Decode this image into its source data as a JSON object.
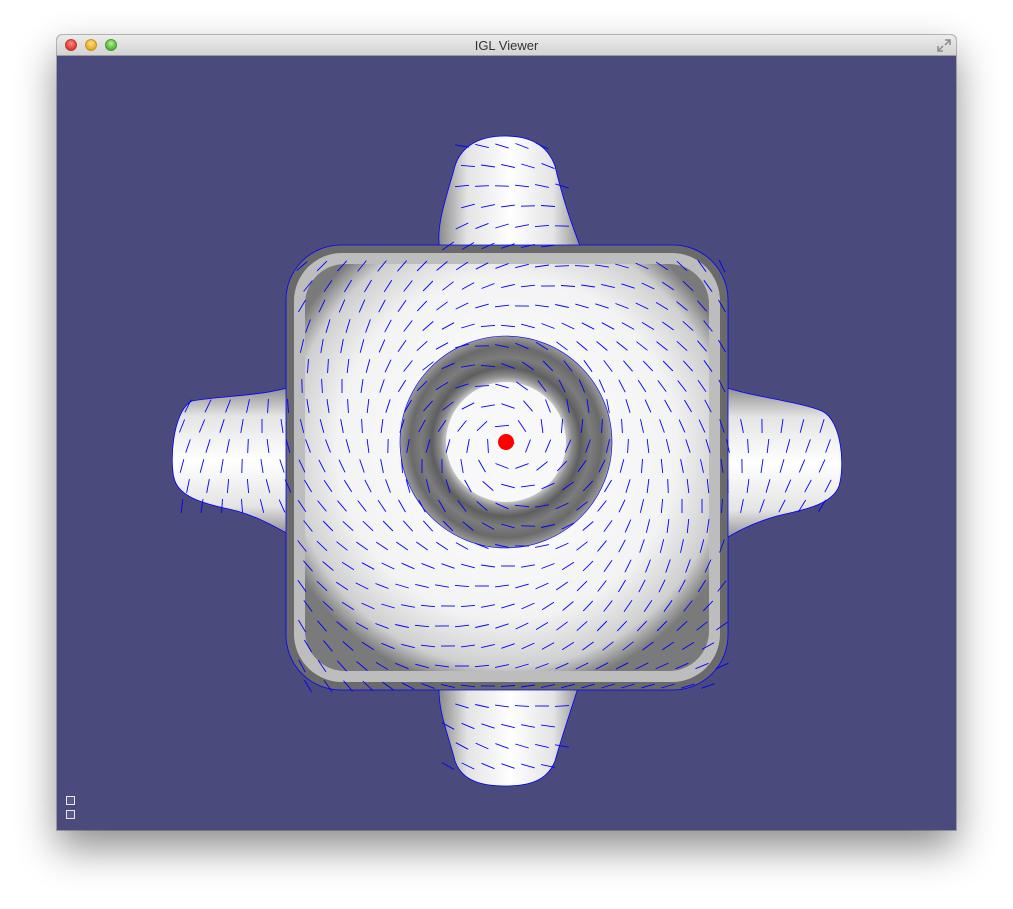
{
  "window": {
    "title": "IGL Viewer"
  },
  "titlebar": {
    "buttons": [
      "close",
      "minimize",
      "zoom"
    ],
    "right_icon": "fullscreen-icon"
  },
  "viewport": {
    "background_color": "#4a4a7d",
    "mesh_color": "#f2f2f2",
    "mesh_shadow_color": "#6e6e6e",
    "vector_field_color": "#0000ff",
    "marker_color": "#ff0000"
  },
  "overlay_buttons": [
    "viewer-menu-toggle-icon",
    "viewer-settings-icon"
  ]
}
